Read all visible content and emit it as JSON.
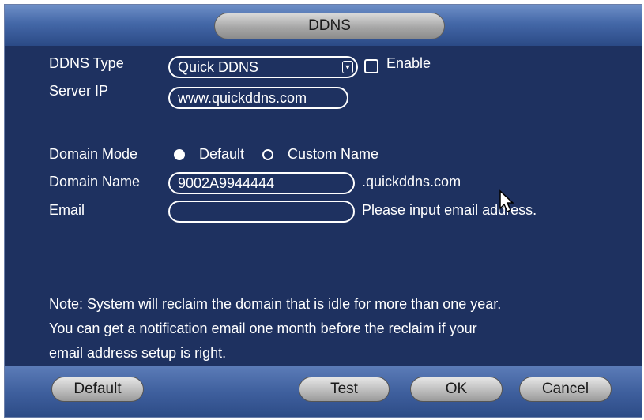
{
  "dialog": {
    "title": "DDNS"
  },
  "form": {
    "ddns_type": {
      "label": "DDNS Type",
      "value": "Quick DDNS",
      "arrow": "▼"
    },
    "enable": {
      "label": "Enable",
      "checked": false
    },
    "server_ip": {
      "label": "Server IP",
      "value": "www.quickddns.com"
    },
    "domain_mode": {
      "label": "Domain Mode",
      "options": [
        {
          "label": "Default",
          "selected": true
        },
        {
          "label": "Custom Name",
          "selected": false
        }
      ]
    },
    "domain_name": {
      "label": "Domain Name",
      "value": "9002A9944444",
      "suffix": ".quickddns.com"
    },
    "email": {
      "label": "Email",
      "value": "",
      "hint": "Please input email address."
    }
  },
  "note": {
    "line1": "Note: System will reclaim the domain that is idle for more than one year.",
    "line2": "You can get a notification email one month before the reclaim if your",
    "line3": "email address setup is right."
  },
  "buttons": {
    "default": "Default",
    "test": "Test",
    "ok": "OK",
    "cancel": "Cancel"
  },
  "colors": {
    "panel": "#1e3160",
    "header": "#4468a8",
    "text": "#ffffff",
    "button": "#bdbdbd"
  }
}
